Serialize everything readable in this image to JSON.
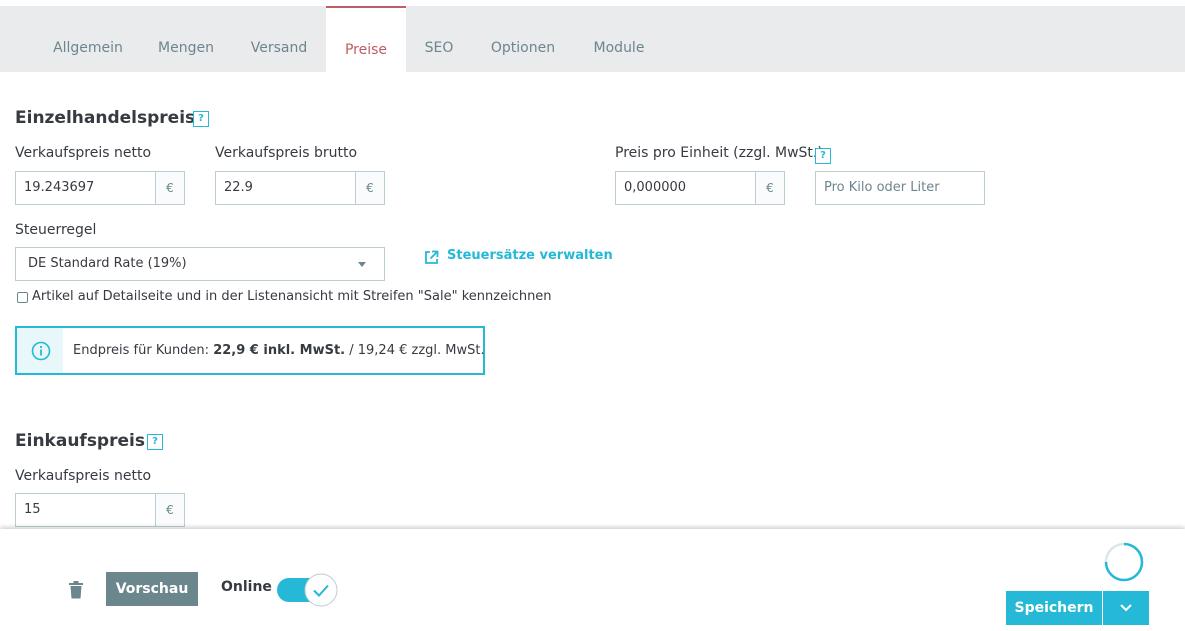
{
  "tabs": [
    {
      "label": "Allgemein",
      "active": false
    },
    {
      "label": "Mengen",
      "active": false
    },
    {
      "label": "Versand",
      "active": false
    },
    {
      "label": "Preise",
      "active": true
    },
    {
      "label": "SEO",
      "active": false
    },
    {
      "label": "Optionen",
      "active": false
    },
    {
      "label": "Module",
      "active": false
    }
  ],
  "retail": {
    "title": "Einzelhandelspreis",
    "help_icon": "?",
    "net_label": "Verkaufspreis netto",
    "net_value": "19.243697",
    "gross_label": "Verkaufspreis brutto",
    "gross_value": "22.9",
    "currency": "€",
    "unit_label": "Preis pro Einheit (zzgl. MwSt.)",
    "unit_value": "0,000000",
    "unit_placeholder": "Pro Kilo oder Liter",
    "tax_label": "Steuerregel",
    "tax_value": "DE Standard Rate (19%)",
    "tax_link": "Steuersätze verwalten",
    "sale_checkbox_label": "Artikel auf Detailseite und in der Listenansicht mit Streifen \"Sale\" kennzeichnen",
    "sale_checked": false,
    "info_prefix": "Endpreis für Kunden: ",
    "info_bold": "22,9 € inkl. MwSt.",
    "info_suffix": " / 19,24 € zzgl. MwSt."
  },
  "purchase": {
    "title": "Einkaufspreis",
    "help_icon": "?",
    "net_label": "Verkaufspreis netto",
    "net_value": "15",
    "currency": "€"
  },
  "footer": {
    "preview_label": "Vorschau",
    "online_label": "Online",
    "online_enabled": true,
    "save_label": "Speichern"
  },
  "colors": {
    "accent": "#25b9d7",
    "active_tab": "#c05c67",
    "secondary": "#6c868e"
  },
  "icons": {
    "help": "help-icon",
    "external_link": "external-link-icon",
    "info": "info-icon",
    "trash": "trash-icon",
    "check": "check-icon",
    "chevron_down": "chevron-down-icon",
    "spinner": "loading-spinner-icon"
  }
}
